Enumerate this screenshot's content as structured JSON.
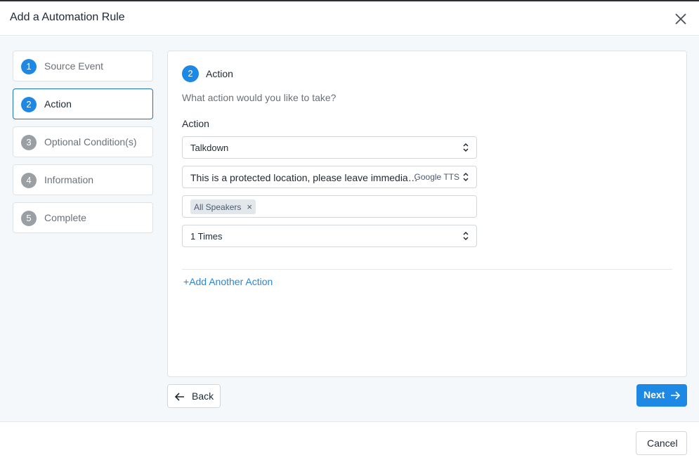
{
  "dialog": {
    "title": "Add a Automation Rule"
  },
  "steps": [
    {
      "num": "1",
      "label": "Source Event",
      "state": "done"
    },
    {
      "num": "2",
      "label": "Action",
      "state": "active"
    },
    {
      "num": "3",
      "label": "Optional Condition(s)",
      "state": "pending"
    },
    {
      "num": "4",
      "label": "Information",
      "state": "pending"
    },
    {
      "num": "5",
      "label": "Complete",
      "state": "pending"
    }
  ],
  "panel": {
    "num": "2",
    "title": "Action",
    "question": "What action would you like to take?",
    "field_label": "Action",
    "action_type": "Talkdown",
    "message": "This is a protected location, please leave immedia…",
    "voice": "Google TTS",
    "speaker_tag": "All Speakers",
    "repeat": "1 Times",
    "add_action_label": "Add Another Action"
  },
  "buttons": {
    "back": "Back",
    "next": "Next",
    "cancel": "Cancel"
  },
  "colors": {
    "accent": "#1e88e5",
    "active_border": "#1f73b7",
    "link": "#2a86d3",
    "inactive_step": "#9a9fa4"
  }
}
